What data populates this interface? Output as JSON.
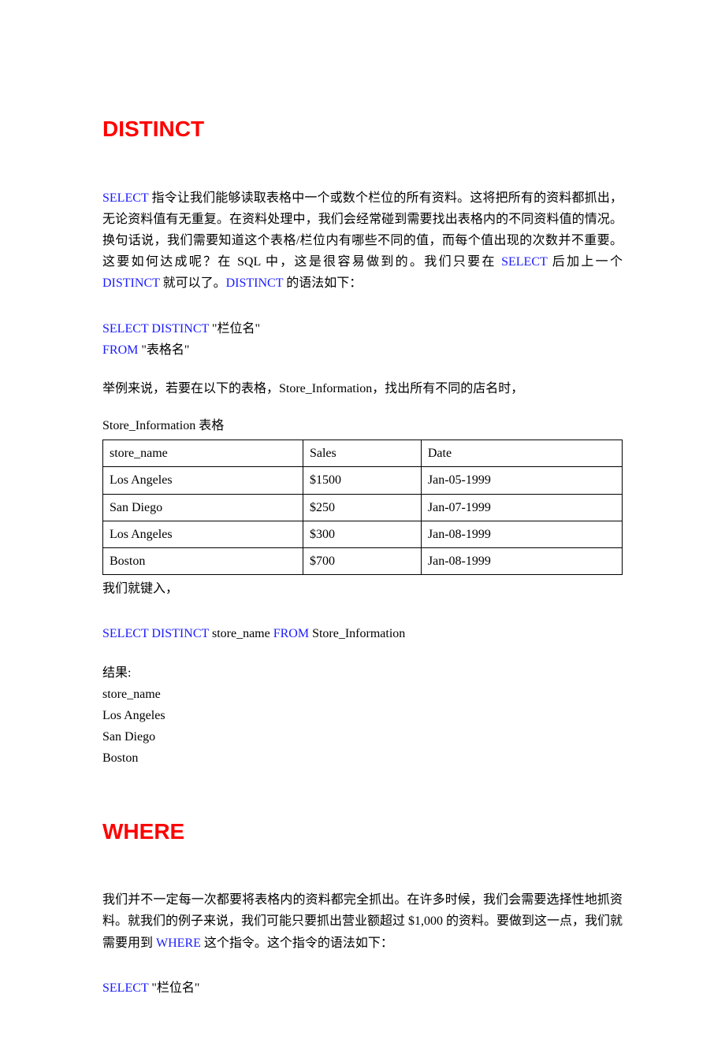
{
  "headings": {
    "distinct": "DISTINCT",
    "where": "WHERE"
  },
  "distinct_section": {
    "para1_pre": "SELECT",
    "para1_mid": " 指令让我们能够读取表格中一个或数个栏位的所有资料。这将把所有的资料都抓出，无论资料值有无重复。在资料处理中，我们会经常碰到需要找出表格内的不同资料值的情况。换句话说，我们需要知道这个表格/栏位内有哪些不同的值，而每个值出现的次数并不重要。这要如何达成呢？在 SQL 中，这是很容易做到的。我们只要在 ",
    "para1_kw2": "SELECT",
    "para1_mid2": " 后加上一个 ",
    "para1_kw3": "DISTINCT",
    "para1_mid3": " 就可以了。",
    "para1_kw4": "DISTINCT",
    "para1_end": " 的语法如下：",
    "syntax_line1_kw": "SELECT DISTINCT",
    "syntax_line1_rest": " \"栏位名\"",
    "syntax_line2_kw": "FROM",
    "syntax_line2_rest": " \"表格名\"",
    "para2": "举例来说，若要在以下的表格，Store_Information，找出所有不同的店名时，",
    "table_caption": "Store_Information 表格",
    "table_headers": [
      "store_name",
      "Sales",
      "Date"
    ],
    "table_rows": [
      [
        "Los Angeles",
        "$1500",
        "Jan-05-1999"
      ],
      [
        "San Diego",
        "$250",
        "Jan-07-1999"
      ],
      [
        "Los Angeles",
        "$300",
        "Jan-08-1999"
      ],
      [
        "Boston",
        "$700",
        "Jan-08-1999"
      ]
    ],
    "after_table": "我们就键入，",
    "query_kw1": "SELECT DISTINCT",
    "query_mid": " store_name ",
    "query_kw2": "FROM",
    "query_end": " Store_Information",
    "result_label": "结果:",
    "result_header": "store_name",
    "result_rows": [
      "Los Angeles",
      "San Diego",
      "Boston"
    ]
  },
  "where_section": {
    "para1_pre": "我们并不一定每一次都要将表格内的资料都完全抓出。在许多时候，我们会需要选择性地抓资料。就我们的例子来说，我们可能只要抓出营业额超过 $1,000 的资料。要做到这一点，我们就需要用到 ",
    "para1_kw": "WHERE",
    "para1_end": " 这个指令。这个指令的语法如下：",
    "syntax_line1_kw": "SELECT",
    "syntax_line1_rest": " \"栏位名\""
  }
}
